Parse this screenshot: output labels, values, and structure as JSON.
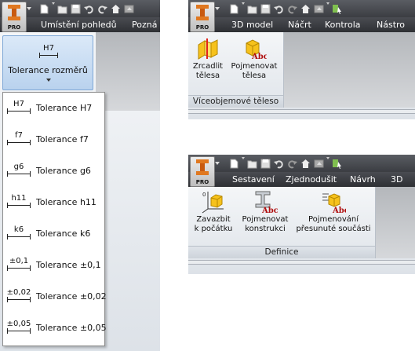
{
  "panel1": {
    "tabs": [
      "Umístění pohledů",
      "Pozná"
    ],
    "button": {
      "icon_text": "H7",
      "label": "Tolerance rozměrů"
    },
    "menu": [
      {
        "sym": "H7",
        "label": "Tolerance H7"
      },
      {
        "sym": "f7",
        "label": "Tolerance f7"
      },
      {
        "sym": "g6",
        "label": "Tolerance g6"
      },
      {
        "sym": "h11",
        "label": "Tolerance h11"
      },
      {
        "sym": "k6",
        "label": "Tolerance k6"
      },
      {
        "sym": "±0,1",
        "label": "Tolerance ±0,1"
      },
      {
        "sym": "±0,02",
        "label": "Tolerance ±0,02"
      },
      {
        "sym": "±0,05",
        "label": "Tolerance ±0,05"
      }
    ]
  },
  "panel2": {
    "tabs": [
      "3D model",
      "Náčrt",
      "Kontrola",
      "Nástro"
    ],
    "buttons": [
      {
        "label1": "Zrcadlit",
        "label2": "tělesa"
      },
      {
        "label1": "Pojmenovat",
        "label2": "tělesa"
      }
    ],
    "group": "Víceobjemové těleso"
  },
  "panel3": {
    "tabs": [
      "Sestavení",
      "Zjednodušit",
      "Návrh",
      "3D"
    ],
    "buttons": [
      {
        "label1": "Zavazbit",
        "label2": "k počátku"
      },
      {
        "label1": "Pojmenovat",
        "label2": "konstrukci"
      },
      {
        "label1": "Pojmenování",
        "label2": "přesunuté součásti"
      }
    ],
    "group": "Definice"
  },
  "logo_text": "PRO",
  "icon_abc": "Abc",
  "colors": {
    "accent": "#e07820",
    "tab_bg": "#3a3c41",
    "selected_button": "#c9def5"
  }
}
